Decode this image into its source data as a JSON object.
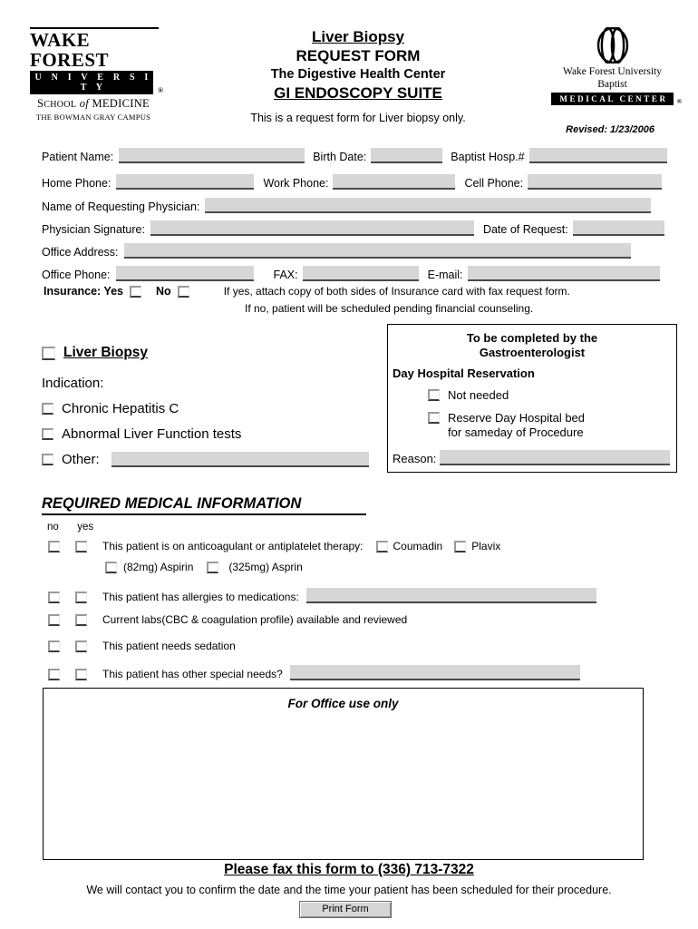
{
  "header": {
    "wake_forest": {
      "line1": "WAKE FOREST",
      "line2": "U N I V E R S I T Y",
      "reg": "®",
      "line3_a": "S",
      "school": "CHOOL",
      "of": "of",
      "medicine": "MEDICINE",
      "campus": "THE BOWMAN GRAY CAMPUS"
    },
    "baptist": {
      "name": "Wake Forest University Baptist",
      "bar": "MEDICAL CENTER",
      "reg": "®"
    },
    "title": {
      "liver_biopsy": "Liver Biopsy",
      "request_form": "REQUEST FORM",
      "digestive": "The Digestive Health Center",
      "gi_suite": "GI ENDOSCOPY SUITE",
      "subtitle": "This is a request form for Liver biopsy only."
    },
    "revised": "Revised: 1/23/2006"
  },
  "patient_info": {
    "patient_name_label": "Patient Name:",
    "birth_date_label": "Birth Date:",
    "baptist_hosp_label": "Baptist Hosp.#",
    "home_phone_label": "Home Phone:",
    "work_phone_label": "Work Phone:",
    "cell_phone_label": "Cell Phone:",
    "requesting_physician_label": "Name of Requesting Physician:",
    "physician_signature_label": "Physician Signature:",
    "date_of_request_label": "Date of Request:",
    "office_address_label": "Office Address:",
    "office_phone_label": "Office Phone:",
    "fax_label": "FAX:",
    "email_label": "E-mail:",
    "patient_name_value": "",
    "birth_date_value": "",
    "baptist_hosp_value": "",
    "home_phone_value": "",
    "work_phone_value": "",
    "cell_phone_value": "",
    "requesting_physician_value": "",
    "physician_signature_value": "",
    "date_of_request_value": "",
    "office_address_value": "",
    "office_phone_value": "",
    "fax_value": "",
    "email_value": ""
  },
  "insurance": {
    "label": "Insurance: Yes",
    "no_label": "No",
    "note_yes": "If yes, attach copy of both sides of Insurance card with fax request form.",
    "note_no": "If no, patient will be scheduled pending financial counseling."
  },
  "liver_biopsy": {
    "heading": "Liver Biopsy",
    "indication_label": "Indication:",
    "options": [
      {
        "label": "Chronic Hepatitis C"
      },
      {
        "label": "Abnormal Liver Function tests"
      },
      {
        "label": "Other:"
      }
    ],
    "other_value": ""
  },
  "gastroenterologist": {
    "title_line1": "To be completed by the",
    "title_line2": "Gastroenterologist",
    "day_hospital_label": "Day Hospital Reservation",
    "options": [
      {
        "line1": "Not needed",
        "line2": ""
      },
      {
        "line1": "Reserve Day Hospital bed",
        "line2": "for sameday of Procedure"
      }
    ],
    "reason_label": "Reason:",
    "reason_value": ""
  },
  "medical_info": {
    "heading": "REQUIRED MEDICAL INFORMATION",
    "col_no": "no",
    "col_yes": "yes",
    "questions": [
      {
        "text": "This patient is on anticoagulant or antiplatelet therapy:"
      },
      {
        "text": "This patient has allergies to medications:",
        "value": ""
      },
      {
        "text": "Current labs(CBC & coagulation profile) available and reviewed"
      },
      {
        "text": "This patient needs sedation"
      },
      {
        "text": "This patient has other special needs?",
        "value": ""
      }
    ],
    "drugs": [
      {
        "label": "Coumadin"
      },
      {
        "label": "Plavix"
      }
    ],
    "aspirin": [
      {
        "label": "(82mg) Aspirin"
      },
      {
        "label": "(325mg) Asprin"
      }
    ]
  },
  "office_use": {
    "title": "For Office use only"
  },
  "footer": {
    "fax_prefix": "Please fax this form to (336) 713-7322",
    "contact": "We will contact you to confirm the date and the time your patient has been scheduled for their procedure.",
    "print_button": "Print Form"
  }
}
